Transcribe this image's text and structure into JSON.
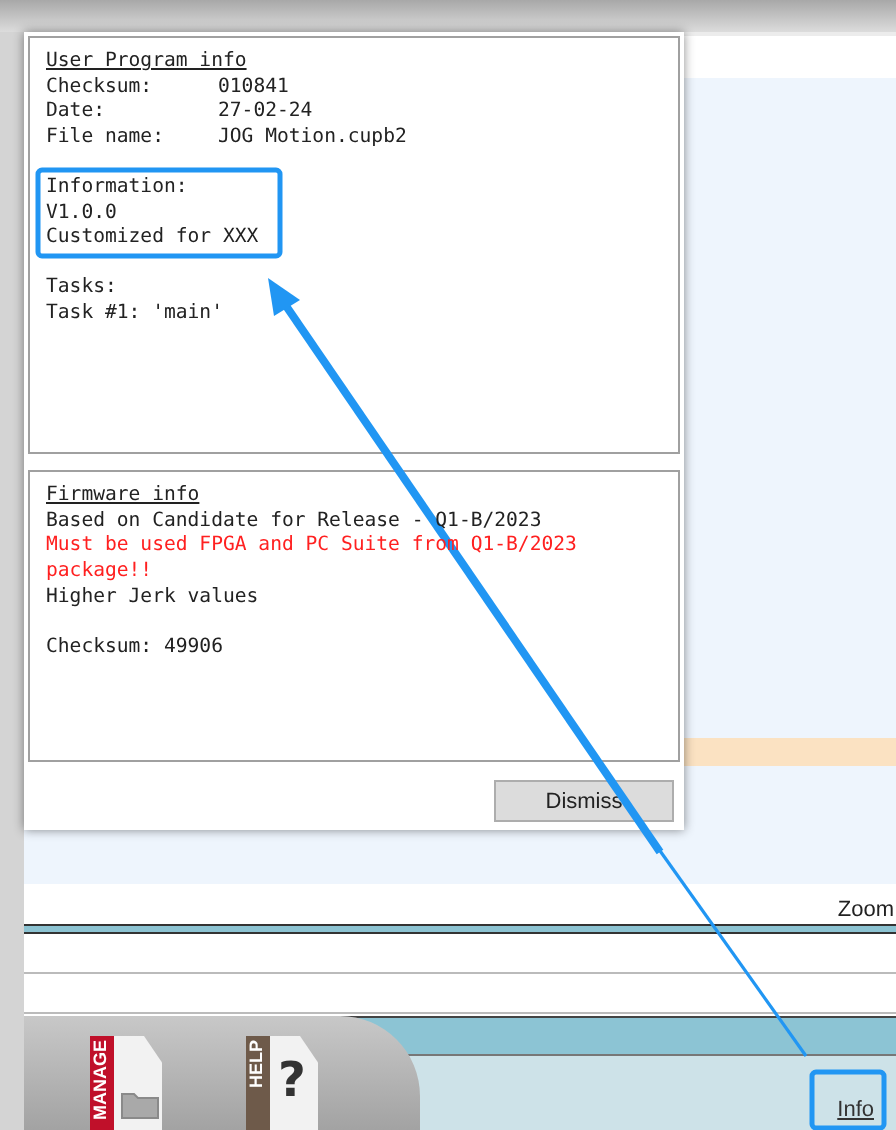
{
  "user_program": {
    "title": "User Program info",
    "fields": [
      {
        "label": "Checksum:",
        "value": "010841"
      },
      {
        "label": "Date:",
        "value": "27-02-24"
      },
      {
        "label": "File name:",
        "value": "JOG Motion.cupb2"
      }
    ],
    "information": [
      "Information:",
      "V1.0.0",
      "Customized for XXX"
    ],
    "tasks": [
      "Tasks:",
      "Task #1: 'main'"
    ]
  },
  "firmware": {
    "title": "Firmware info",
    "lines": [
      {
        "kind": "normal",
        "text": "Based on Candidate for Release - Q1-B/2023"
      },
      {
        "kind": "warning",
        "text": "Must be used FPGA and PC Suite from Q1-B/2023 package!!"
      },
      {
        "kind": "normal",
        "text": "Higher Jerk values"
      },
      {
        "kind": "gap",
        "text": "Checksum: 49906"
      }
    ]
  },
  "dismiss_button": "Dismiss",
  "background": {
    "zoom_label": "Zoom",
    "tabs": [
      {
        "kind": "manage",
        "label": "MANAGE"
      },
      {
        "kind": "help",
        "label": "HELP",
        "glyph": "?"
      }
    ],
    "info_link": "Info"
  }
}
